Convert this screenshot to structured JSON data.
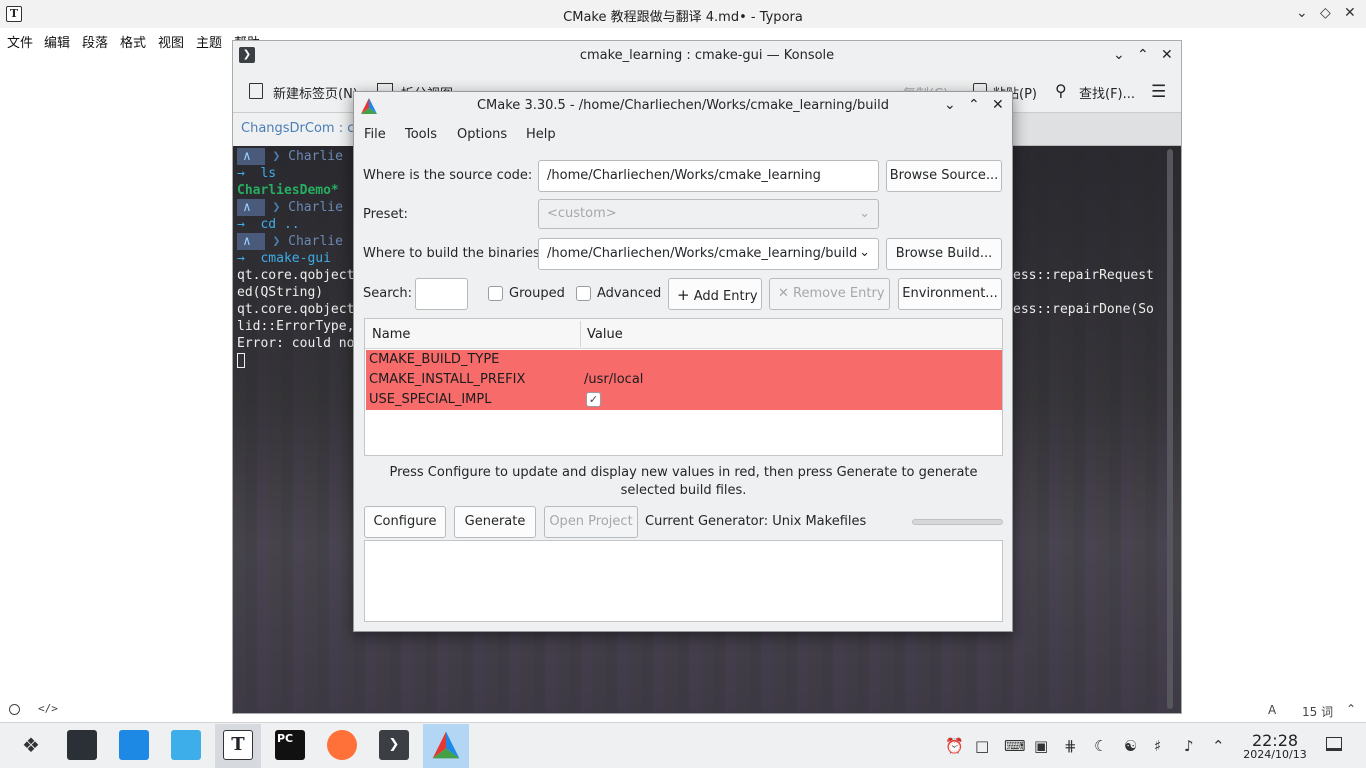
{
  "typora": {
    "title": "CMake 教程跟做与翻译 4.md• - Typora",
    "menus": [
      "文件",
      "编辑",
      "段落",
      "格式",
      "视图",
      "主题",
      "帮助"
    ],
    "word_count": "15 词"
  },
  "konsole": {
    "title": "cmake_learning : cmake-gui — Konsole",
    "toolbar": {
      "new_tab": "新建标签页(N)",
      "split_view": "拆分视图",
      "copy": "复制(C)",
      "paste": "粘贴(P)",
      "find": "查找(F)..."
    },
    "tab_label": "ChangsDrCom : cy",
    "prompt_user": "Charlie",
    "lines": {
      "l1_cmd": "→  ls",
      "l2_out": "CharliesDemo*",
      "l3_cmd": "→  cd ..",
      "l4_cmd": "→  cmake-gui",
      "l5": "qt.core.qobject",
      "l5_right": "ess::repairRequest",
      "l6": "ed(QString)",
      "l7": "qt.core.qobject",
      "l7_right": "ess::repairDone(So",
      "l8": "lid::ErrorType,",
      "l9": "Error: could no"
    }
  },
  "cmake": {
    "title": "CMake 3.30.5 - /home/Charliechen/Works/cmake_learning/build",
    "menus": [
      "File",
      "Tools",
      "Options",
      "Help"
    ],
    "source_label": "Where is the source code:",
    "source_value": "/home/Charliechen/Works/cmake_learning",
    "browse_source": "Browse Source...",
    "preset_label": "Preset:",
    "preset_value": "<custom>",
    "build_label": "Where to build the binaries:",
    "build_value": "/home/Charliechen/Works/cmake_learning/build",
    "browse_build": "Browse Build...",
    "search_label": "Search:",
    "search_value": "",
    "grouped": "Grouped",
    "advanced": "Advanced",
    "add_entry": "Add Entry",
    "remove_entry": "Remove Entry",
    "environment": "Environment...",
    "table_headers": [
      "Name",
      "Value"
    ],
    "entries": [
      {
        "name": "CMAKE_BUILD_TYPE",
        "value": ""
      },
      {
        "name": "CMAKE_INSTALL_PREFIX",
        "value": "/usr/local"
      },
      {
        "name": "USE_SPECIAL_IMPL",
        "value": "ON"
      }
    ],
    "entry_highlight_color": "#f76b6b",
    "hint": "Press Configure to update and display new values in red, then press Generate to generate selected build files.",
    "configure": "Configure",
    "generate": "Generate",
    "open_project": "Open Project",
    "generator": "Current Generator: Unix Makefiles"
  },
  "taskbar": {
    "time": "22:28",
    "date": "2024/10/13"
  }
}
